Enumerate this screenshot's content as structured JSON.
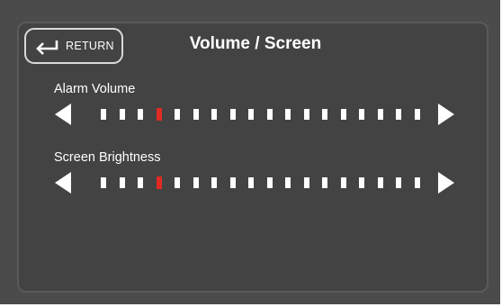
{
  "header": {
    "return_label": "RETURN",
    "title": "Volume / Screen"
  },
  "sliders": [
    {
      "label": "Alarm Volume",
      "level": 4,
      "steps": 18
    },
    {
      "label": "Screen Brightness",
      "level": 4,
      "steps": 18
    }
  ],
  "colors": {
    "background": "#4b4b4b",
    "panel": "#434343",
    "tick": "#ffffff",
    "active_tick": "#e02b24"
  },
  "icons": {
    "return": "return-arrow-icon",
    "decrease": "triangle-left-icon",
    "increase": "triangle-right-icon"
  }
}
